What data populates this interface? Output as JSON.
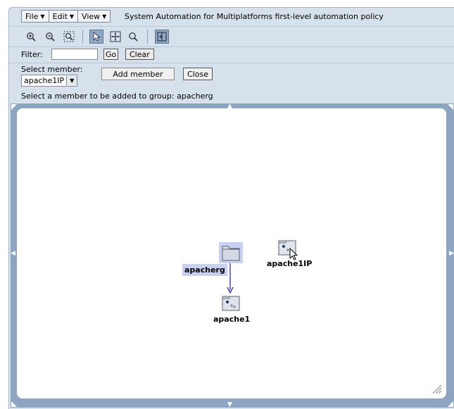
{
  "menubar": {
    "menus": [
      {
        "label": "File",
        "arrow": "▼"
      },
      {
        "label": "Edit",
        "arrow": "▼"
      },
      {
        "label": "View",
        "arrow": "▼"
      }
    ],
    "title": "System Automation for Multiplatforms first-level automation policy"
  },
  "toolbar": {
    "icons": [
      "zoom-in-icon",
      "zoom-out-icon",
      "zoom-fit-icon",
      "select-pointer-icon",
      "pan-move-icon",
      "find-icon",
      "overview-icon"
    ],
    "active_tool": "select-pointer-icon"
  },
  "filter": {
    "label": "Filter:",
    "value": "",
    "go_label": "Go",
    "clear_label": "Clear"
  },
  "member": {
    "select_label": "Select member:",
    "selected": "apache1IP",
    "add_label": "Add member",
    "close_label": "Close",
    "hint": "Select a member to be added to group: apacherg"
  },
  "graph": {
    "nodes": {
      "group": "apacherg",
      "member": "apache1",
      "candidate": "apache1IP"
    }
  },
  "colors": {
    "panel_bg": "#d7e1ec",
    "viewport_frame": "#8da5c1",
    "selection_highlight": "#c9cff0",
    "edge_arrow": "#1a1aa8"
  }
}
